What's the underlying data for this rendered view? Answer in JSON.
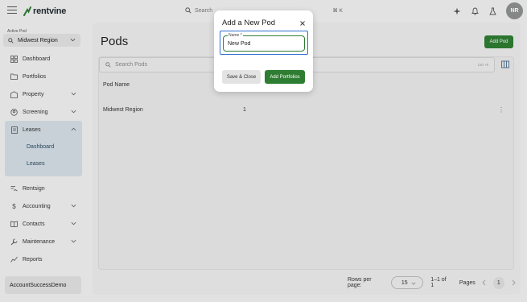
{
  "brand": {
    "name": "rentvine",
    "accent": "#2e7d32"
  },
  "topbar": {
    "search_placeholder": "Search",
    "search_shortcut": "⌘ K",
    "icons": [
      "menu-icon",
      "sparkle-icon",
      "bell-icon",
      "flask-icon"
    ],
    "avatar_initials": "NR"
  },
  "sidebar": {
    "active_pod_label": "Active Pod",
    "active_pod_value": "Midwest Region",
    "items": [
      {
        "label": "Dashboard",
        "icon": "dashboard-icon"
      },
      {
        "label": "Portfolios",
        "icon": "folder-icon"
      },
      {
        "label": "Property",
        "icon": "building-icon",
        "expandable": true
      },
      {
        "label": "Screening",
        "icon": "screening-icon",
        "expandable": true
      },
      {
        "label": "Leases",
        "icon": "leases-icon",
        "expanded": true,
        "children": [
          {
            "label": "Dashboard"
          },
          {
            "label": "Leases"
          }
        ]
      },
      {
        "label": "Rentsign",
        "icon": "signature-icon"
      },
      {
        "label": "Accounting",
        "icon": "dollar-icon",
        "expandable": true
      },
      {
        "label": "Contacts",
        "icon": "contacts-icon",
        "expandable": true
      },
      {
        "label": "Maintenance",
        "icon": "wrench-icon",
        "expandable": true
      },
      {
        "label": "Reports",
        "icon": "reports-icon"
      }
    ],
    "account_name": "AccountSuccessDemo"
  },
  "main": {
    "title": "Pods",
    "add_button": "Add Pod",
    "search_placeholder": "Search Pods",
    "search_hint": "Ctrl +k",
    "columns": [
      "Pod Name",
      ""
    ],
    "rows": [
      {
        "name": "Midwest Region",
        "count": "1"
      }
    ],
    "pagination": {
      "rows_per_page_label": "Rows per page:",
      "rows_per_page_value": "15",
      "range": "1–1 of 1",
      "pages_label": "Pages",
      "current_page": "1"
    }
  },
  "dialog": {
    "title": "Add a New Pod",
    "field_label": "Name *",
    "field_value": "New Pod",
    "save_close_label": "Save & Close",
    "add_portfolios_label": "Add Portfolios"
  }
}
